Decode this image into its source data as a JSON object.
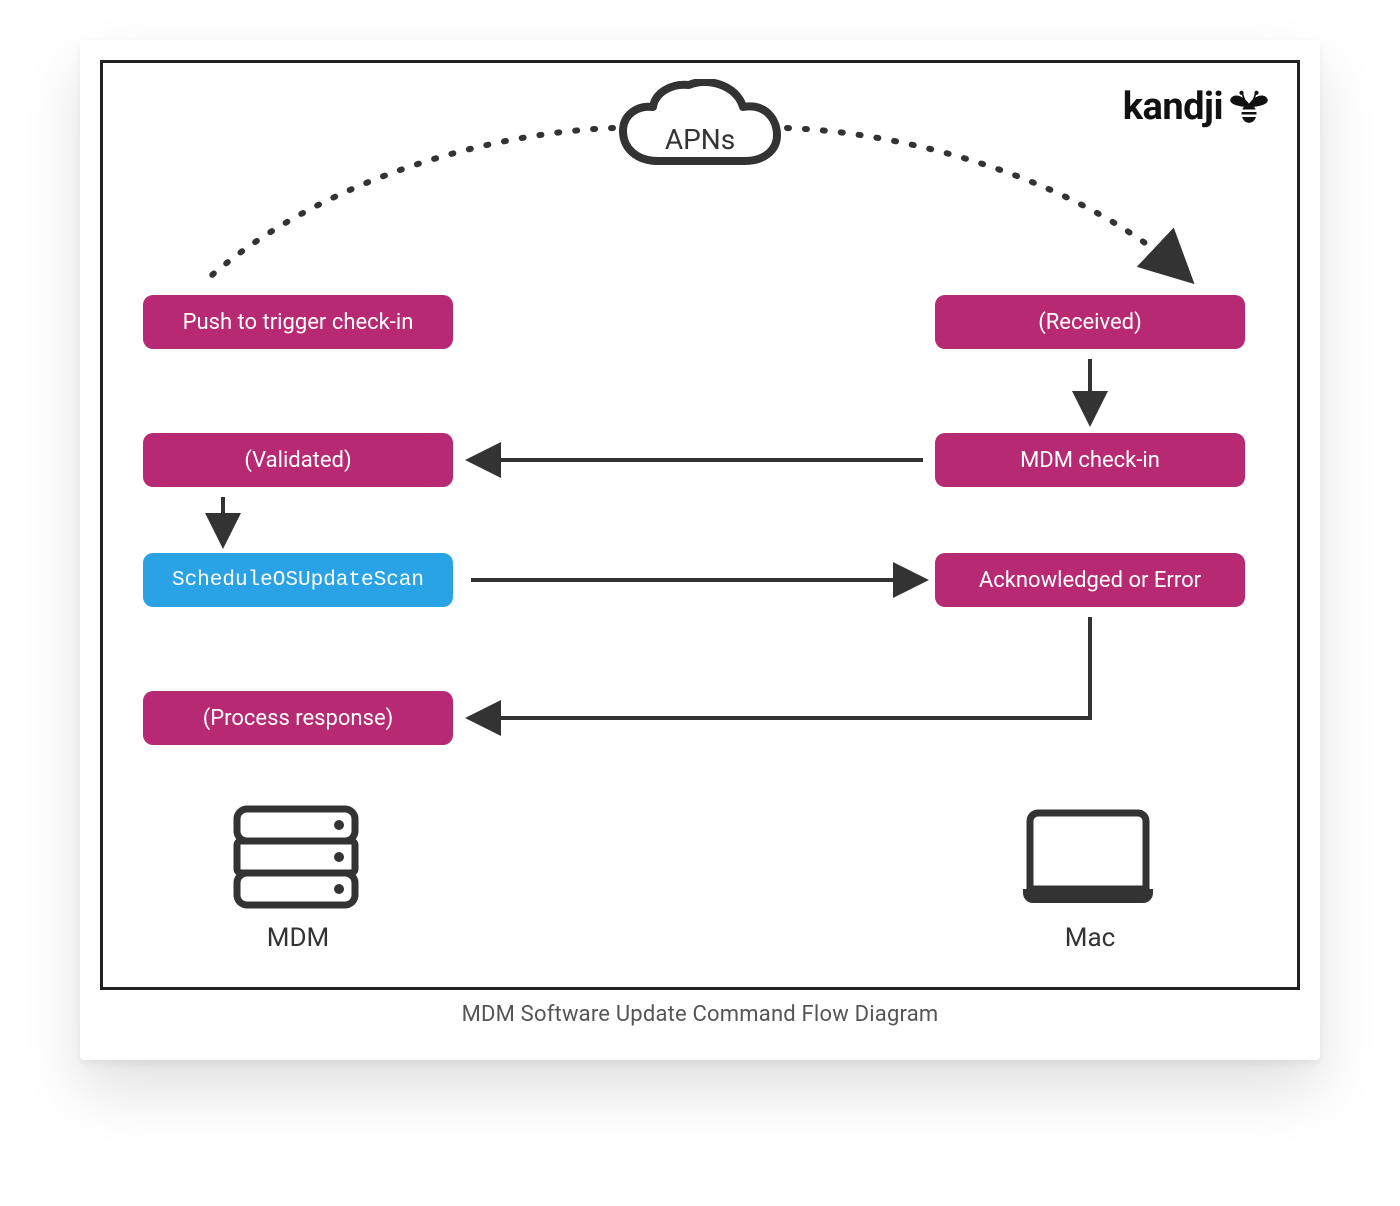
{
  "caption": "MDM Software Update Command Flow Diagram",
  "brand": "kandji",
  "apns_label": "APNs",
  "boxes": {
    "push": "Push to trigger check-in",
    "received": "(Received)",
    "validated": "(Validated)",
    "checkin": "MDM check-in",
    "schedule": "ScheduleOSUpdateScan",
    "ack": "Acknowledged or Error",
    "process": "(Process response)"
  },
  "columns": {
    "left": "MDM",
    "right": "Mac"
  },
  "colors": {
    "pink": "#b72a73",
    "blue": "#2aa3e6",
    "line": "#333333"
  },
  "flow": [
    {
      "from": "APNs (cloud)",
      "to": "Push to trigger check-in",
      "style": "dotted-arc"
    },
    {
      "from": "APNs (cloud)",
      "to": "(Received)",
      "style": "dotted-arc"
    },
    {
      "from": "(Received)",
      "to": "MDM check-in",
      "style": "arrow-down"
    },
    {
      "from": "MDM check-in",
      "to": "(Validated)",
      "style": "arrow-left"
    },
    {
      "from": "(Validated)",
      "to": "ScheduleOSUpdateScan",
      "style": "arrow-down"
    },
    {
      "from": "ScheduleOSUpdateScan",
      "to": "Acknowledged or Error",
      "style": "arrow-right"
    },
    {
      "from": "Acknowledged or Error",
      "to": "(Process response)",
      "style": "arrow-elbow-left"
    }
  ]
}
